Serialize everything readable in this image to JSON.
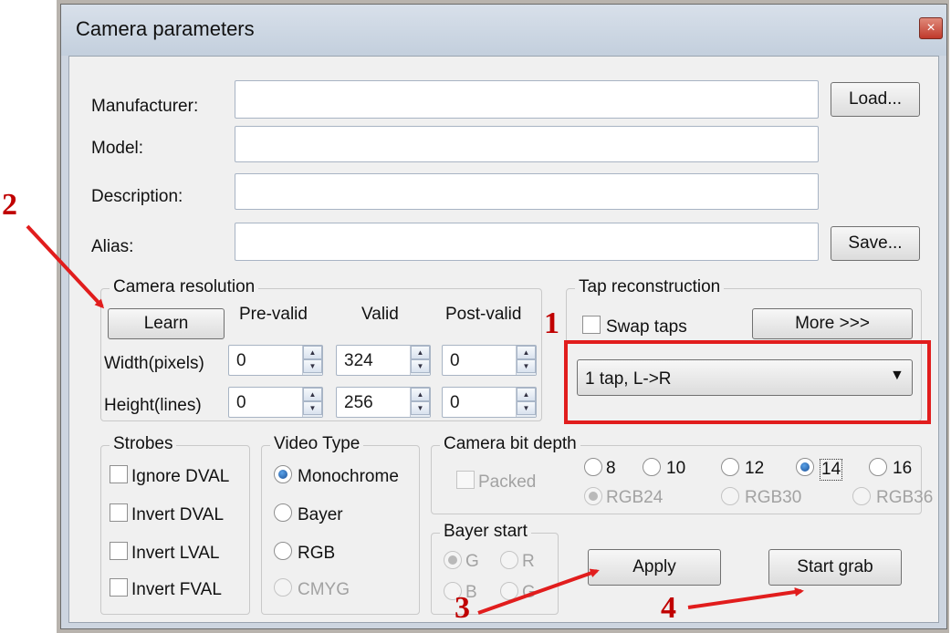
{
  "window": {
    "title": "Camera parameters",
    "close_glyph": "×"
  },
  "info": {
    "manufacturer_label": "Manufacturer:",
    "model_label": "Model:",
    "description_label": "Description:",
    "alias_label": "Alias:",
    "manufacturer_value": "",
    "model_value": "",
    "description_value": "",
    "alias_value": "",
    "load_label": "Load...",
    "save_label": "Save..."
  },
  "resolution": {
    "group_title": "Camera resolution",
    "learn_label": "Learn",
    "col_pre": "Pre-valid",
    "col_valid": "Valid",
    "col_post": "Post-valid",
    "width_label": "Width(pixels)",
    "height_label": "Height(lines)",
    "width_pre": "0",
    "width_valid": "324",
    "width_post": "0",
    "height_pre": "0",
    "height_valid": "256",
    "height_post": "0"
  },
  "tap": {
    "group_title": "Tap reconstruction",
    "swap_label": "Swap taps",
    "more_label": "More >>>",
    "selected": "1 tap, L->R"
  },
  "strobes": {
    "group_title": "Strobes",
    "items": [
      "Ignore DVAL",
      "Invert DVAL",
      "Invert LVAL",
      "Invert FVAL"
    ]
  },
  "video": {
    "group_title": "Video Type",
    "items": [
      "Monochrome",
      "Bayer",
      "RGB",
      "CMYG"
    ],
    "selected": "Monochrome"
  },
  "bitdepth": {
    "group_title": "Camera bit depth",
    "packed_label": "Packed",
    "mono": [
      "8",
      "10",
      "12",
      "14",
      "16"
    ],
    "selected": "14",
    "rgb": [
      "RGB24",
      "RGB30",
      "RGB36"
    ]
  },
  "bayer": {
    "group_title": "Bayer start",
    "items": [
      "G",
      "R",
      "B",
      "G"
    ]
  },
  "actions": {
    "apply_label": "Apply",
    "start_label": "Start grab"
  },
  "annotations": {
    "a1": "1",
    "a2": "2",
    "a3": "3",
    "a4": "4"
  },
  "colors": {
    "annotation_red": "#e11d1d",
    "selected_radio": "#1b4f96"
  },
  "icons": {
    "close": "close-icon",
    "spin_up": "arrow-up-icon",
    "spin_down": "arrow-down-icon",
    "dropdown": "dropdown-arrow-icon"
  }
}
